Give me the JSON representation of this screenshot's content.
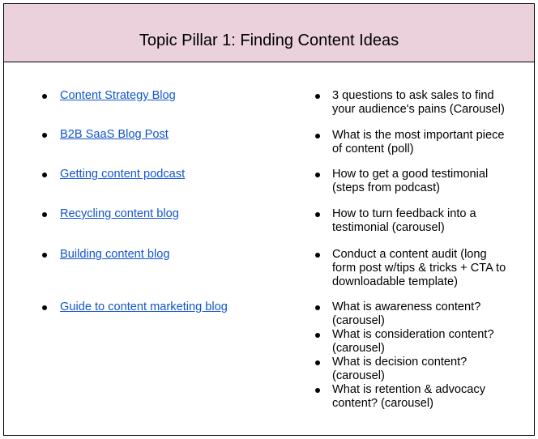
{
  "header": {
    "title": "Topic Pillar 1: Finding Content Ideas",
    "background_color": "#ead1dc"
  },
  "link_color": "#1155cc",
  "left_column": {
    "links": [
      {
        "label": "Content Strategy Blog"
      },
      {
        "label": "B2B SaaS Blog Post"
      },
      {
        "label": "Getting content podcast"
      },
      {
        "label": "Recycling content blog"
      },
      {
        "label": "Building content blog"
      },
      {
        "label": "Guide to content marketing blog"
      }
    ]
  },
  "right_column": {
    "items": [
      {
        "line1": "3 questions to ask sales to find",
        "line2": "your audience's pains (Carousel)"
      },
      {
        "line1": "What is the most important piece",
        "line2": "of content (poll)"
      },
      {
        "line1": "How to get a good testimonial",
        "line2": "(steps from podcast)"
      },
      {
        "line1": "How to turn feedback into a",
        "line2": "testimonial (carousel)"
      },
      {
        "line1": "Conduct a content audit (long",
        "line2": "form post w/tips & tricks + CTA to",
        "line3": "downloadable template)"
      },
      {
        "line1": "What is awareness content?",
        "line2": "(carousel)"
      },
      {
        "line1": "What is consideration content?",
        "line2": "(carousel)"
      },
      {
        "line1": "What is decision content?",
        "line2": "(carousel)"
      },
      {
        "line1": "What is retention & advocacy",
        "line2": "content? (carousel)"
      }
    ]
  }
}
